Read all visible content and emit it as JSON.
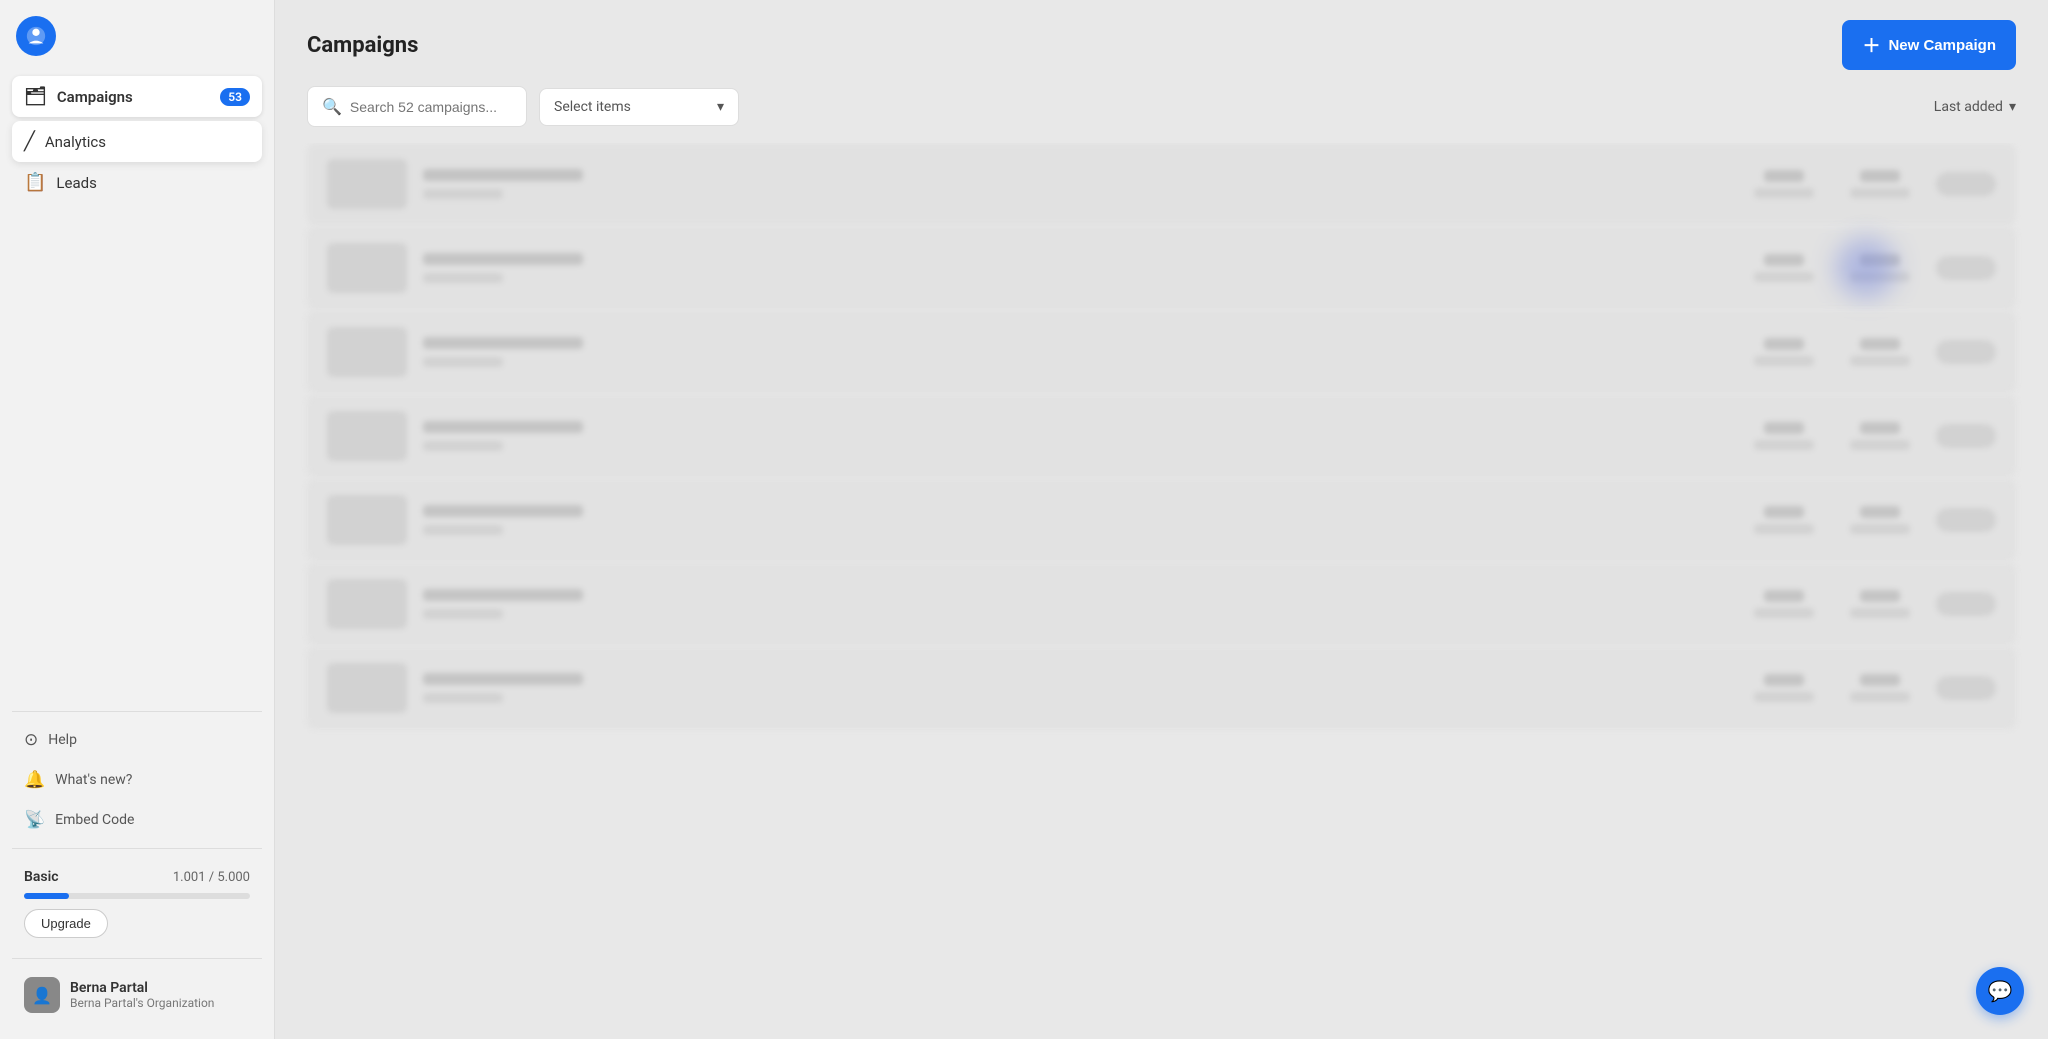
{
  "sidebar": {
    "logo_alt": "App logo",
    "campaigns_label": "Campaigns",
    "campaigns_badge": "53",
    "analytics_label": "Analytics",
    "leads_label": "Leads",
    "help_label": "Help",
    "whats_new_label": "What's new?",
    "embed_code_label": "Embed Code",
    "plan_label": "Basic",
    "plan_usage": "1.001 / 5.000",
    "plan_bar_percent": 20,
    "upgrade_label": "Upgrade",
    "user_name": "Berna Partal",
    "user_org": "Berna Partal's Organization"
  },
  "header": {
    "page_title": "Campaigns",
    "new_campaign_label": "New Campaign"
  },
  "toolbar": {
    "search_placeholder": "Search 52 campaigns...",
    "select_items_label": "Select items",
    "sort_label": "Last added"
  },
  "campaigns": {
    "rows": [
      {
        "id": 1
      },
      {
        "id": 2
      },
      {
        "id": 3
      },
      {
        "id": 4
      },
      {
        "id": 5
      },
      {
        "id": 6
      },
      {
        "id": 7
      }
    ]
  }
}
